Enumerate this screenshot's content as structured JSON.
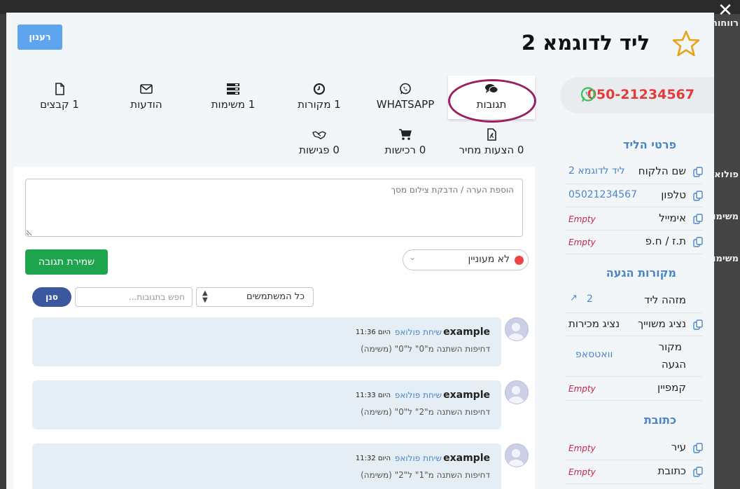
{
  "background": {
    "peek_items": [
      "רווחות",
      "פולואו",
      "משימות",
      "משימות"
    ]
  },
  "modal": {
    "refresh_label": "רענון",
    "title": "ליד לדוגמא 2",
    "phone": "050-21234567"
  },
  "tabs": [
    {
      "label": "תגובות",
      "icon": "chat-icon"
    },
    {
      "label": "WHATSAPP",
      "icon": "whatsapp-icon"
    },
    {
      "label": "1 מקורות",
      "icon": "clock-icon"
    },
    {
      "label": "1 משימות",
      "icon": "tasks-icon"
    },
    {
      "label": "הודעות",
      "icon": "envelope-icon"
    },
    {
      "label": "1 קבצים",
      "icon": "file-icon"
    },
    {
      "label": "0 הצעות מחיר",
      "icon": "pdf-icon"
    },
    {
      "label": "0 רכישות",
      "icon": "cart-icon"
    },
    {
      "label": "0 פגישות",
      "icon": "handshake-icon"
    }
  ],
  "comments_panel": {
    "note_placeholder": "הוספת הערה / הדבקת צילום מסך",
    "save_label": "שמירת תגובה",
    "status_value": "לא מעוניין",
    "users_filter": "כל המשתמשים",
    "search_placeholder": "חפש בתגובות...",
    "filter_label": "סנן",
    "comments": [
      {
        "author": "example",
        "type": "שיחת פולואפ",
        "time": "היום 11:36",
        "body": "דחיפות השתנה מ\"0\" ל\"0\" (משימה)"
      },
      {
        "author": "example",
        "type": "שיחת פולואפ",
        "time": "היום 11:33",
        "body": "דחיפות השתנה מ\"2\" ל\"0\" (משימה)"
      },
      {
        "author": "example",
        "type": "שיחת פולואפ",
        "time": "היום 11:32",
        "body": "דחיפות השתנה מ\"1\" ל\"2\" (משימה)"
      }
    ]
  },
  "details": {
    "lead_section": "פרטי הליד",
    "lead_rows": [
      {
        "label": "שם הלקוח",
        "value": "ליד לדוגמא 2"
      },
      {
        "label": "טלפון",
        "value": "05021234567"
      },
      {
        "label": "אימייל",
        "value": "Empty"
      },
      {
        "label": "ת.ז / ח.פ",
        "value": "Empty"
      }
    ],
    "sources_section": "מקורות הגעה",
    "sources_rows": [
      {
        "label": "מזהה ליד",
        "value": "2"
      },
      {
        "label": "נציג משוייך",
        "value": "נציג מכירות"
      },
      {
        "label": "מקור",
        "label2": "הגעה",
        "value": "וואטסאפ"
      },
      {
        "label": "קמפיין",
        "value": "Empty"
      }
    ],
    "address_section": "כתובת",
    "address_rows": [
      {
        "label": "עיר",
        "value": "Empty"
      },
      {
        "label": "כתובת",
        "value": "Empty"
      }
    ]
  },
  "colors": {
    "accent_blue": "#4a86c8",
    "save_green": "#1fa44e",
    "phone_red": "#e23b3b",
    "empty_red": "#c0264d",
    "annotation": "#9b1f63"
  }
}
